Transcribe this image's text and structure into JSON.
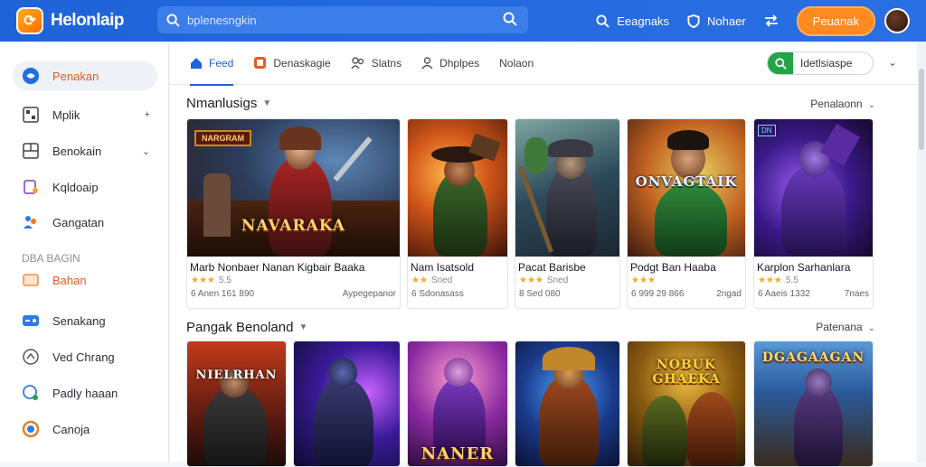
{
  "app": {
    "title": "Helonlaip"
  },
  "search": {
    "placeholder": "bplenesngkin"
  },
  "header": {
    "links": [
      {
        "label": "Eeagnaks",
        "icon": "search-icon"
      },
      {
        "label": "Nohaer",
        "icon": "shield-icon"
      },
      {
        "label": "",
        "icon": "transfer-icon"
      }
    ],
    "cta_label": "Peuanak"
  },
  "sidebar": {
    "items": [
      {
        "label": "Penakan",
        "icon": "home-icon",
        "active": true
      },
      {
        "label": "Mplik",
        "icon": "grid-icon",
        "chevron": true
      },
      {
        "label": "Benokain",
        "icon": "box-icon",
        "chevron": true
      },
      {
        "label": "Kqldoaip",
        "icon": "puzzle-icon"
      },
      {
        "label": "Gangatan",
        "icon": "people-icon"
      },
      {
        "label": "Senakang",
        "icon": "gamepad-icon"
      },
      {
        "label": "Ved Chrang",
        "icon": "video-icon"
      },
      {
        "label": "Padly haaan",
        "icon": "globe-icon"
      },
      {
        "label": "Canoja",
        "icon": "circle-icon"
      }
    ],
    "section_heading": "DBA BAGIN",
    "section_link": "Bahan"
  },
  "tabs": [
    {
      "label": "Feed",
      "icon": "home-icon",
      "active": true
    },
    {
      "label": "Denaskagie",
      "icon": "store-icon"
    },
    {
      "label": "Slatns",
      "icon": "people-icon"
    },
    {
      "label": "Dhplpes",
      "icon": "person-icon"
    },
    {
      "label": "Nolaon",
      "icon": ""
    }
  ],
  "filter": {
    "label": "Idetlsiaspe"
  },
  "sections": [
    {
      "title": "Nmanlusigs",
      "right_label": "Penalaonn",
      "cards": [
        {
          "name": "Marb Nonbaer Nanan Kigbair Baaka",
          "art_title": "NAVARAKA",
          "badge": "NARGRAM",
          "stars": "★★★",
          "rating": "5.5",
          "meta_left": "6 Anen 161 890",
          "meta_right": "Aypegepanor"
        },
        {
          "name": "Nam Isatsold",
          "art_title": "",
          "badge": "",
          "stars": "★★",
          "rating": "Sned",
          "meta_left": "6 Sdonasass",
          "meta_right": ""
        },
        {
          "name": "Pacat Barisbe",
          "art_title": "",
          "badge": "",
          "stars": "★★★",
          "rating": "Sned",
          "meta_left": "8 Sed 080",
          "meta_right": ""
        },
        {
          "name": "Podgt Ban Haaba",
          "art_title": "ONVAGTAIK",
          "badge": "",
          "stars": "★★★",
          "rating": "",
          "meta_left": "6 999 29 866",
          "meta_right": "2ngad"
        },
        {
          "name": "Karplon Sarhanlara",
          "art_title": "",
          "badge": "DN",
          "stars": "★★★",
          "rating": "5.5",
          "meta_left": "6 Aaeis 1332",
          "meta_right": "7naes"
        }
      ]
    },
    {
      "title": "Pangak Benoland",
      "right_label": "Patenana",
      "cards": [
        {
          "art_title": "NIELRHAN"
        },
        {
          "art_title": ""
        },
        {
          "art_title": "NANER"
        },
        {
          "art_title": ""
        },
        {
          "art_title": "NOBUK GHAEKA"
        },
        {
          "art_title": "DGAGAAGAN"
        }
      ]
    }
  ],
  "colors": {
    "brand": "#1f63d8",
    "accent": "#ff8a1f",
    "active_text": "#e35d1f",
    "star": "#f1a92b"
  }
}
